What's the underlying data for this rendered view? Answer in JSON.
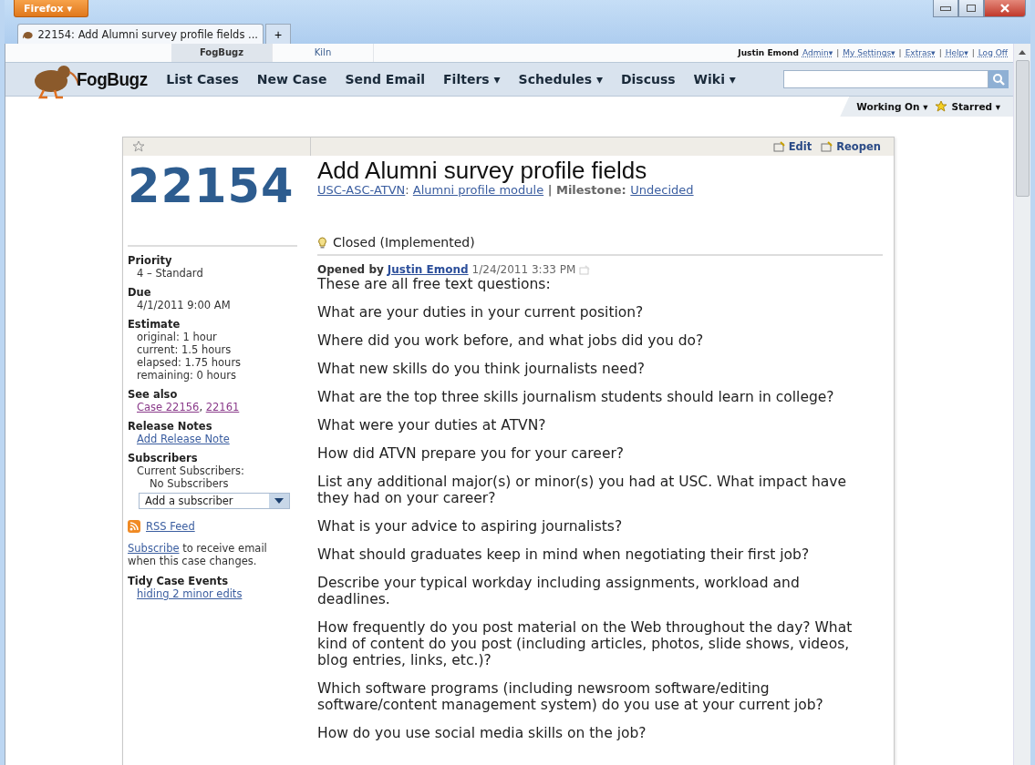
{
  "browser": {
    "menu_button": "Firefox ▾",
    "tab_title": "22154: Add Alumni survey profile fields ...",
    "new_tab": "+"
  },
  "app_tabs": [
    {
      "label": "FogBugz",
      "selected": true
    },
    {
      "label": "Kiln",
      "selected": false
    }
  ],
  "user": {
    "name": "Justin Emond",
    "links": [
      "Admin▾",
      "My Settings▾",
      "Extras▾",
      "Help▾",
      "Log Off"
    ],
    "separator": "|"
  },
  "nav": {
    "logo": "FogBugz",
    "items": [
      "List Cases",
      "New Case",
      "Send Email",
      "Filters ▾",
      "Schedules ▾",
      "Discuss",
      "Wiki ▾"
    ]
  },
  "sub_nav": {
    "working_on": "Working On ▾",
    "starred": "Starred ▾"
  },
  "case": {
    "starred": false,
    "number": "22154",
    "title": "Add Alumni survey profile fields",
    "project": "USC-ASC-ATVN",
    "project_separator": ":",
    "area": "Alumni profile module",
    "milestone_separator": "|",
    "milestone_label": "Milestone:",
    "milestone": "Undecided",
    "actions": [
      "Edit",
      "Reopen"
    ],
    "status": "Closed (Implemented)"
  },
  "sidebar": [
    {
      "heading": "Priority",
      "items": [
        {
          "kind": "text",
          "text": "4 – Standard"
        }
      ]
    },
    {
      "heading": "Due",
      "items": [
        {
          "kind": "text",
          "text": "4/1/2011 9:00 AM"
        }
      ]
    },
    {
      "heading": "Estimate",
      "items": [
        {
          "kind": "text",
          "text": "original: 1 hour"
        },
        {
          "kind": "text",
          "text": "current: 1.5 hours"
        },
        {
          "kind": "text",
          "text": "elapsed: 1.75 hours"
        },
        {
          "kind": "text",
          "text": "remaining: 0 hours"
        }
      ]
    },
    {
      "heading": "See also",
      "items": [
        {
          "kind": "links",
          "links": [
            "Case 22156",
            "22161"
          ],
          "separator": ","
        }
      ]
    },
    {
      "heading": "Release Notes",
      "items": [
        {
          "kind": "link",
          "text": "Add Release Note"
        }
      ]
    },
    {
      "heading": "Subscribers",
      "items": [
        {
          "kind": "text",
          "text": "Current Subscribers:"
        },
        {
          "kind": "note",
          "text": "No Subscribers"
        },
        {
          "kind": "select",
          "text": "Add a subscriber"
        }
      ]
    }
  ],
  "rss": "RSS Feed",
  "subscribe": {
    "link": "Subscribe",
    "text": "to receive email when this case changes."
  },
  "tidy": {
    "heading": "Tidy Case Events",
    "link": "hiding 2 minor edits"
  },
  "event": {
    "opened_label": "Opened by",
    "author": "Justin Emond",
    "date": "1/24/2011 3:33 PM",
    "paragraphs": [
      "These are all free text questions:",
      "What are your duties in your current position?",
      "Where did you work before, and what jobs did you do?",
      "What new skills do you think journalists need?",
      "What are the top three skills journalism students should learn in college?",
      "What were your duties at ATVN?",
      "How did ATVN prepare you for your career?",
      "List any additional major(s) or minor(s) you had at USC. What impact have they had on your career?",
      "What is your advice to aspiring journalists?",
      "What should graduates keep in mind when negotiating their first job?",
      "Describe your typical workday including assignments, workload and deadlines.",
      "How frequently do you post material on the Web throughout the day? What kind of content do you post (including articles, photos, slide shows, videos, blog entries, links, etc.)?",
      "Which software programs (including newsroom software/editing software/content management system) do you use at your current job?",
      "How do you use social media skills on the job?"
    ]
  }
}
